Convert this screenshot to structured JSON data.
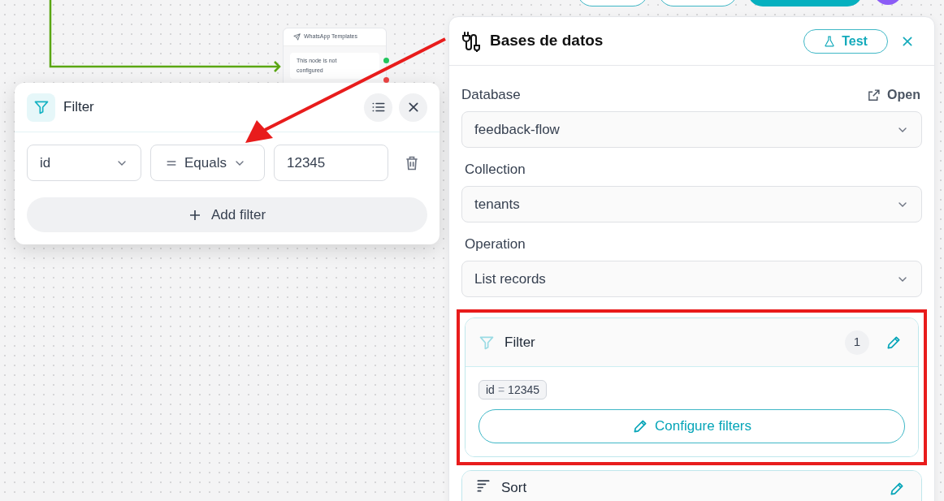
{
  "canvas": {
    "node": {
      "title": "WhatsApp Templates",
      "message": "This node is not configured"
    }
  },
  "filter_popup": {
    "title": "Filter",
    "rows": [
      {
        "field": "id",
        "operator": "Equals",
        "value": "12345"
      }
    ],
    "add_button": "Add filter"
  },
  "panel": {
    "title": "Bases de datos",
    "test_button": "Test",
    "fields": [
      {
        "label": "Database",
        "action": "Open",
        "value": "feedback-flow"
      },
      {
        "label": "Collection",
        "value": "tenants"
      },
      {
        "label": "Operation",
        "value": "List records"
      }
    ],
    "sections": [
      {
        "kind": "filter",
        "title": "Filter",
        "count": "1",
        "highlighted": true,
        "chips": [
          {
            "field": "id",
            "operator": "=",
            "value": "12345"
          }
        ],
        "button": "Configure filters"
      },
      {
        "kind": "sort",
        "title": "Sort",
        "highlighted": false
      }
    ]
  }
}
